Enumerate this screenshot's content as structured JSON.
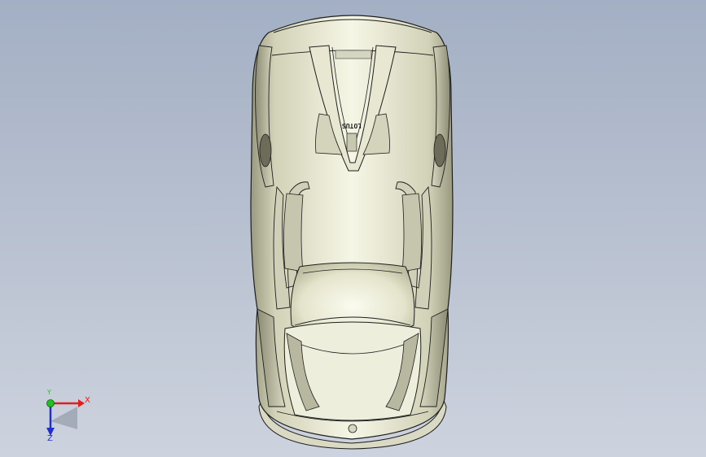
{
  "model": {
    "badge_text": "LOTUS"
  },
  "triad": {
    "x_label": "X",
    "y_label": "Y",
    "z_label": "Z",
    "x_color": "#e02020",
    "y_color": "#20c020",
    "z_color": "#2030d0"
  },
  "colors": {
    "background_top": "#a3afc4",
    "background_bottom": "#cdd3de",
    "body_paint": "#ececd8",
    "outline": "#1e1e1e"
  }
}
